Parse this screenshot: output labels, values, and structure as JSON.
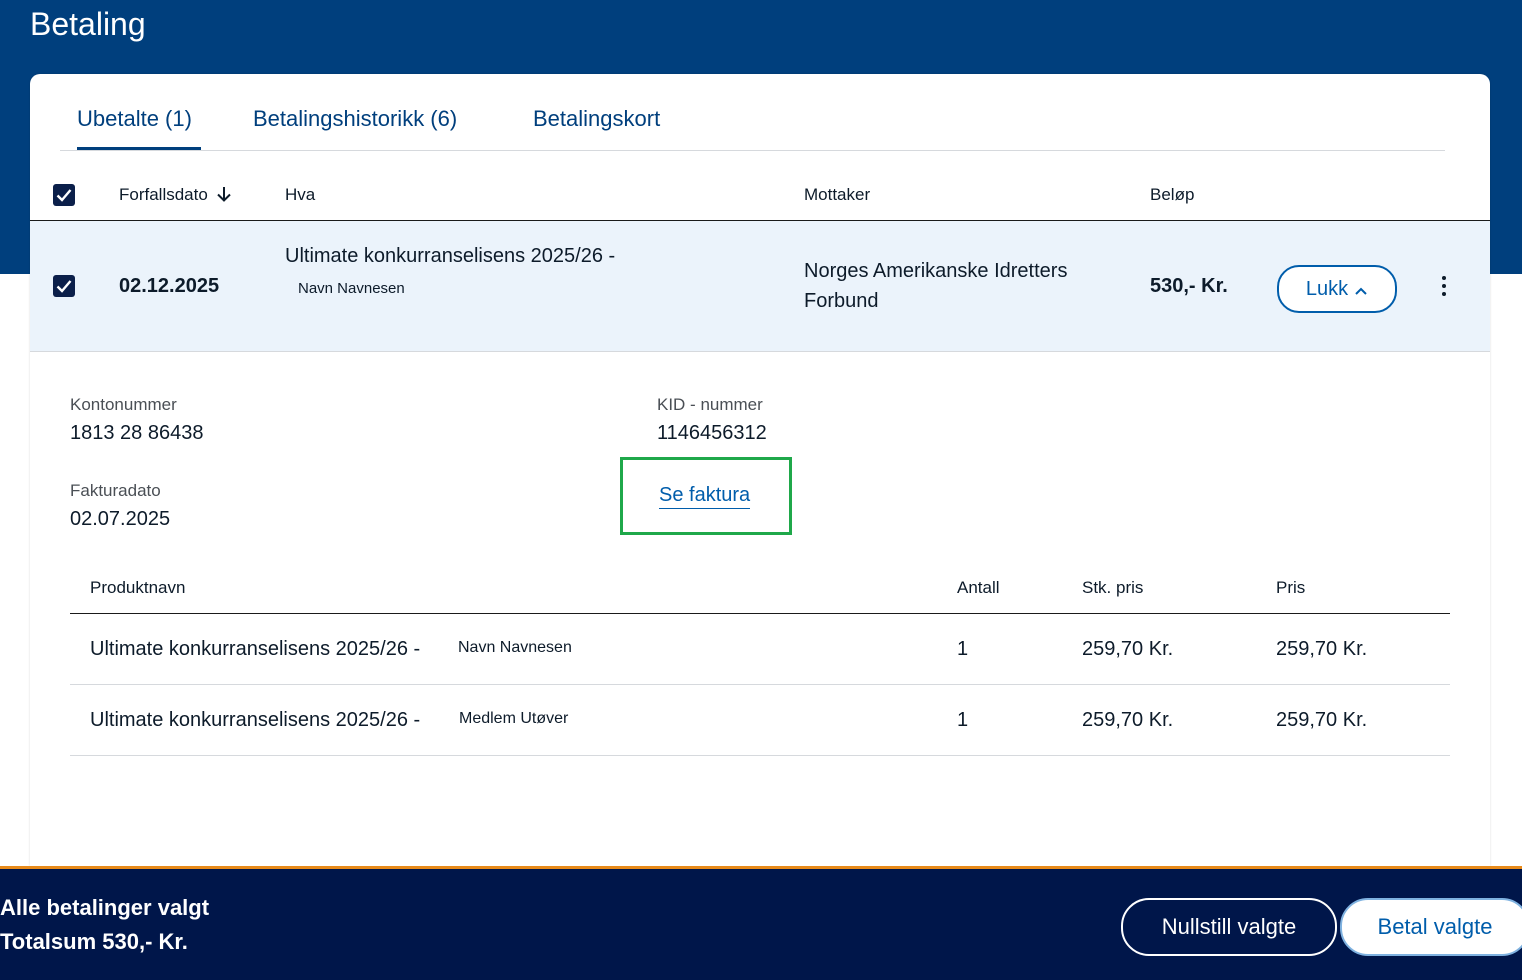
{
  "page": {
    "title": "Betaling"
  },
  "tabs": [
    {
      "label": "Ubetalte (1)",
      "active": true
    },
    {
      "label": "Betalingshistorikk (6)",
      "active": false
    },
    {
      "label": "Betalingskort",
      "active": false
    }
  ],
  "table": {
    "headers": {
      "due_date": "Forfallsdato",
      "what": "Hva",
      "recipient": "Mottaker",
      "amount": "Beløp"
    },
    "rows": [
      {
        "due_date": "02.12.2025",
        "what_title": "Ultimate konkurranselisens 2025/26 -",
        "what_person": "Navn Navnesen",
        "recipient_line1": "Norges Amerikanske Idretters",
        "recipient_line2": "Forbund",
        "amount": "530,- Kr.",
        "toggle_label": "Lukk",
        "selected": true
      }
    ]
  },
  "details": {
    "account_label": "Kontonummer",
    "account_value": "1813 28 86438",
    "kid_label": "KID - nummer",
    "kid_value": "1146456312",
    "invoice_date_label": "Fakturadato",
    "invoice_date_value": "02.07.2025",
    "invoice_link": "Se faktura"
  },
  "products": {
    "headers": {
      "name": "Produktnavn",
      "qty": "Antall",
      "unit_price": "Stk. pris",
      "price": "Pris"
    },
    "rows": [
      {
        "name": "Ultimate konkurranselisens 2025/26 -",
        "person": "Navn Navnesen",
        "qty": "1",
        "unit_price": "259,70 Kr.",
        "price": "259,70 Kr."
      },
      {
        "name": "Ultimate konkurranselisens 2025/26 -",
        "person": "Medlem Utøver",
        "qty": "1",
        "unit_price": "259,70 Kr.",
        "price": "259,70 Kr."
      }
    ]
  },
  "footer": {
    "selection_text": "Alle betalinger valgt",
    "total_text": "Totalsum 530,- Kr.",
    "reset_label": "Nullstill valgte",
    "pay_label": "Betal valgte"
  },
  "colors": {
    "brand_blue": "#003f7d",
    "link_blue": "#005dab",
    "footer_navy": "#00164a",
    "row_highlight": "#ebf3fb",
    "focus_green": "#1fa84a",
    "footer_accent": "#e88a1a"
  },
  "icons": {
    "sort": "arrow-down-icon",
    "toggle": "chevron-up-icon",
    "more": "kebab-menu-icon",
    "checkbox": "checkmark-icon"
  }
}
